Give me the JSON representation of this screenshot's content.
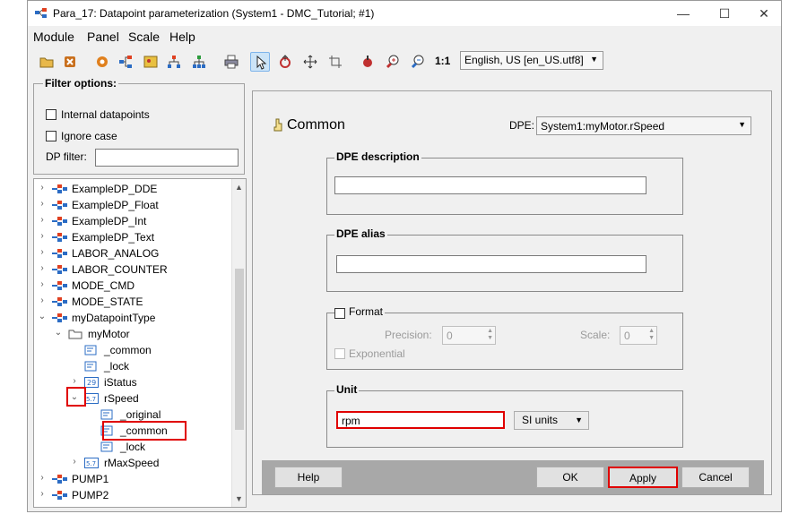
{
  "window": {
    "title": "Para_17: Datapoint parameterization (System1 - DMC_Tutorial; #1)",
    "minimize": "—",
    "maximize": "☐",
    "close": "✕"
  },
  "menu": [
    "Module",
    "Panel",
    "Scale",
    "Help"
  ],
  "toolbar": {
    "zoom_label": "1:1",
    "language": "English, US [en_US.utf8]"
  },
  "filter": {
    "legend": "Filter options:",
    "internal_label": "Internal datapoints",
    "ignore_case_label": "Ignore case",
    "dp_filter_label": "DP filter:",
    "dp_filter_value": ""
  },
  "tree": [
    {
      "label": "ExampleDP_DDE",
      "icon": "dptype-icon",
      "expander": ">",
      "indent": 0
    },
    {
      "label": "ExampleDP_Float",
      "icon": "dptype-icon",
      "expander": ">",
      "indent": 0
    },
    {
      "label": "ExampleDP_Int",
      "icon": "dptype-icon",
      "expander": ">",
      "indent": 0
    },
    {
      "label": "ExampleDP_Text",
      "icon": "dptype-icon",
      "expander": ">",
      "indent": 0
    },
    {
      "label": "LABOR_ANALOG",
      "icon": "dptype-icon",
      "expander": ">",
      "indent": 0
    },
    {
      "label": "LABOR_COUNTER",
      "icon": "dptype-icon",
      "expander": ">",
      "indent": 0
    },
    {
      "label": "MODE_CMD",
      "icon": "dptype-icon",
      "expander": ">",
      "indent": 0
    },
    {
      "label": "MODE_STATE",
      "icon": "dptype-icon",
      "expander": ">",
      "indent": 0
    },
    {
      "label": "myDatapointType",
      "icon": "dptype-icon",
      "expander": "v",
      "indent": 0
    },
    {
      "label": "myMotor",
      "icon": "folder-icon",
      "expander": "v",
      "indent": 1
    },
    {
      "label": "_common",
      "icon": "config-icon",
      "expander": "",
      "indent": 2
    },
    {
      "label": "_lock",
      "icon": "config-icon",
      "expander": "",
      "indent": 2
    },
    {
      "label": "iStatus",
      "icon": "int-icon",
      "expander": ">",
      "indent": 2
    },
    {
      "label": "rSpeed",
      "icon": "float-icon",
      "expander": "v",
      "indent": 2
    },
    {
      "label": "_original",
      "icon": "config-icon",
      "expander": "",
      "indent": 3
    },
    {
      "label": "_common",
      "icon": "config-icon",
      "expander": "",
      "indent": 3
    },
    {
      "label": "_lock",
      "icon": "config-icon",
      "expander": "",
      "indent": 3
    },
    {
      "label": "rMaxSpeed",
      "icon": "float-icon",
      "expander": ">",
      "indent": 2
    },
    {
      "label": "PUMP1",
      "icon": "dptype-icon",
      "expander": ">",
      "indent": 0
    },
    {
      "label": "PUMP2",
      "icon": "dptype-icon",
      "expander": ">",
      "indent": 0
    }
  ],
  "tree_icon_text": {
    "int": "29",
    "float": "5.7"
  },
  "panel": {
    "heading": "Common",
    "dpe_label": "DPE:",
    "dpe_value": "System1:myMotor.rSpeed",
    "description_legend": "DPE description",
    "description_value": "",
    "alias_legend": "DPE alias",
    "alias_value": "",
    "format_legend": "Format",
    "precision_label": "Precision:",
    "precision_value": "0",
    "scale_label": "Scale:",
    "scale_value": "0",
    "exponential_label": "Exponential",
    "unit_legend": "Unit",
    "unit_value": "rpm",
    "units_button": "SI units"
  },
  "buttons": {
    "help": "Help",
    "ok": "OK",
    "apply": "Apply",
    "cancel": "Cancel"
  },
  "colors": {
    "highlight": "#e00000",
    "footer": "#a8a8a8",
    "selection": "#cce4f7"
  }
}
